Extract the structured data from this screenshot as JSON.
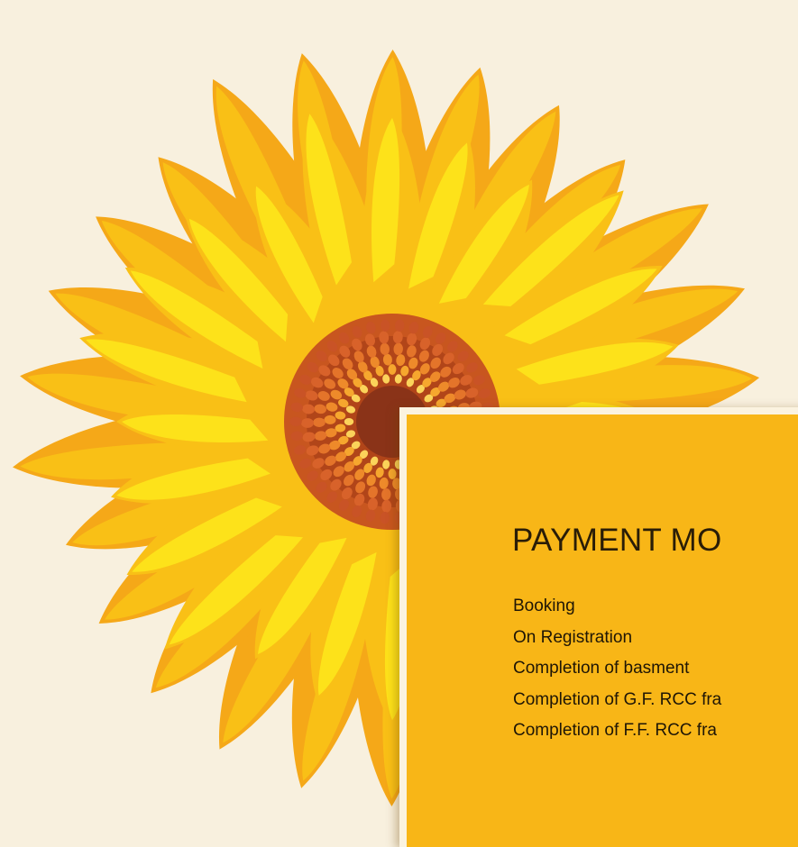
{
  "colors": {
    "background": "#f8f0de",
    "card": "#f8b617",
    "petal_outer": "#f5a818",
    "petal_mid": "#f9c016",
    "petal_tip": "#fde21a",
    "center_ring": "#c8561f",
    "center_core": "#8a3318"
  },
  "decoration": {
    "image": "sunflower-illustration"
  },
  "card": {
    "title": "PAYMENT MO",
    "items": [
      "Booking",
      "On Registration",
      "Completion of basment",
      "Completion of G.F. RCC fra",
      "Completion of F.F. RCC fra"
    ]
  }
}
